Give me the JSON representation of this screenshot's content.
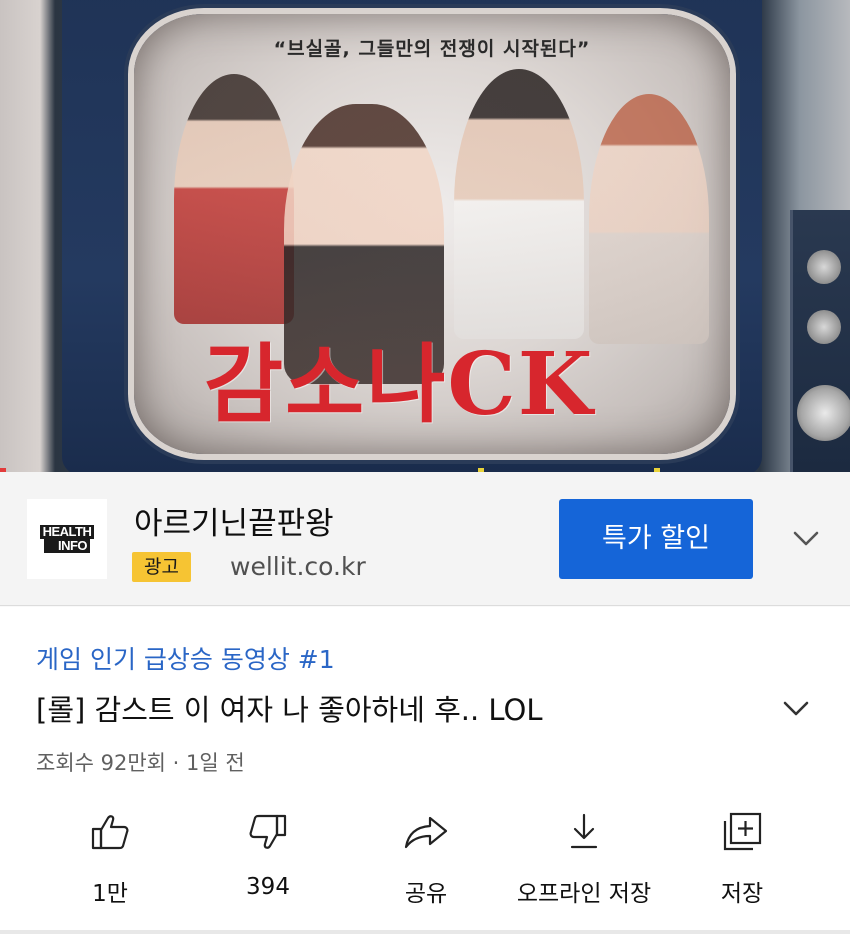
{
  "video": {
    "tagline": "“브실골, 그들만의 전쟁이 시작된다”",
    "title_art": "감소나CK"
  },
  "ad": {
    "logo_line1": "HEALTH",
    "logo_line2": "INFO",
    "title": "아르기닌끝판왕",
    "badge": "광고",
    "domain": "wellit.co.kr",
    "cta": "특가 할인",
    "expand_icon": "chevron-down-icon"
  },
  "info": {
    "hashtag": "게임 인기 급상승 동영상 #1",
    "title": "[롤] 감스트 이 여자 나 좋아하네 후.. LOL",
    "meta": "조회수 92만회 · 1일 전"
  },
  "actions": [
    {
      "icon": "thumbs-up-icon",
      "label": "1만"
    },
    {
      "icon": "thumbs-down-icon",
      "label": "394"
    },
    {
      "icon": "share-icon",
      "label": "공유"
    },
    {
      "icon": "download-icon",
      "label": "오프라인 저장"
    },
    {
      "icon": "save-playlist-icon",
      "label": "저장"
    }
  ],
  "colors": {
    "accent_blue": "#1565d8",
    "hashtag_blue": "#2a66c6",
    "ad_badge": "#f6c433",
    "title_art_red": "#d7262d"
  }
}
